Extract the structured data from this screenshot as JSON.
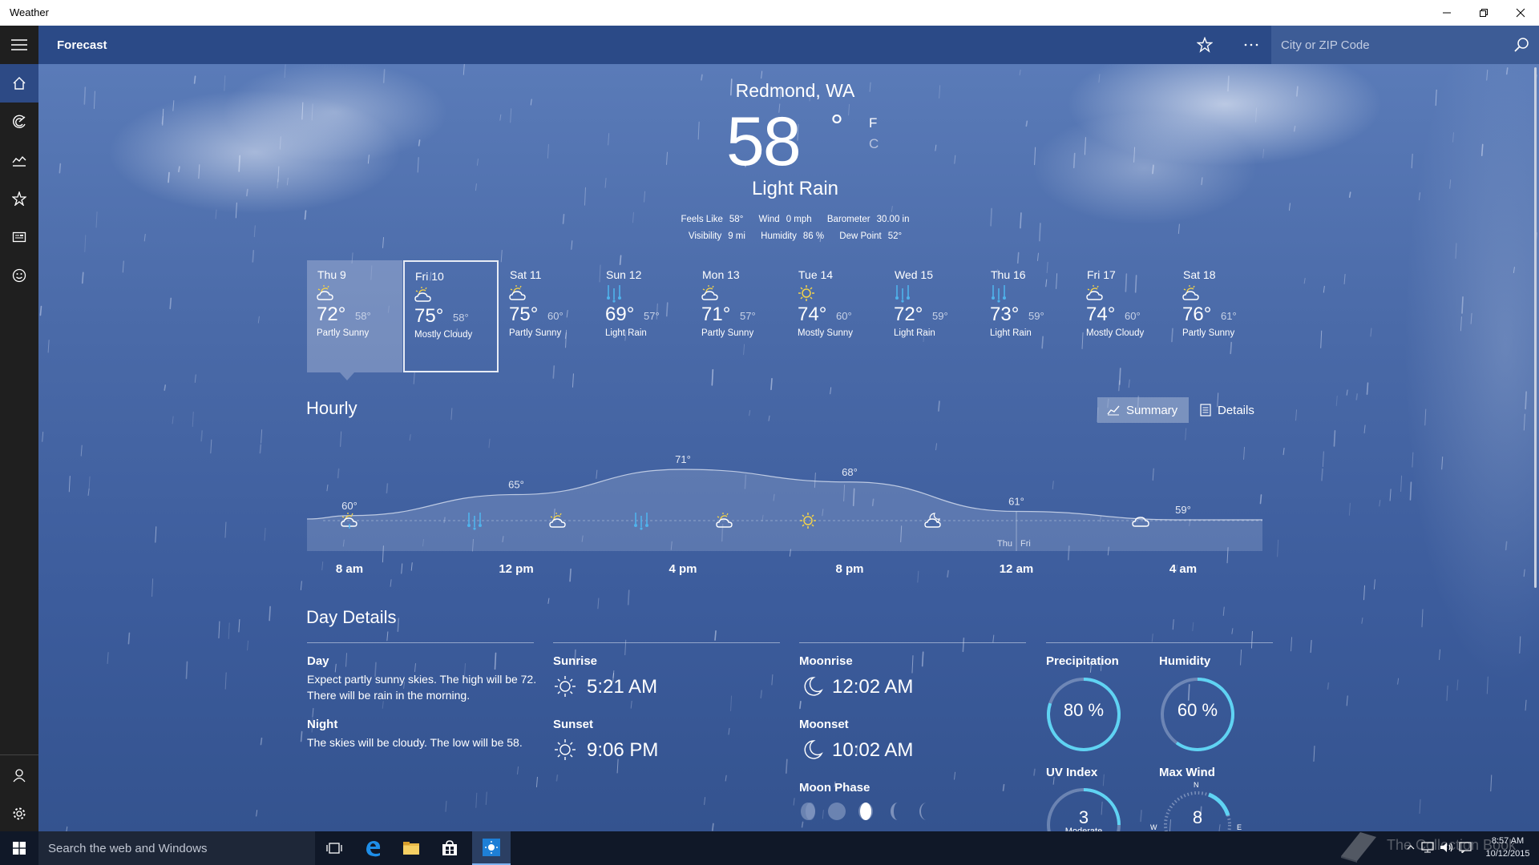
{
  "window": {
    "title": "Weather"
  },
  "header": {
    "title": "Forecast",
    "search_placeholder": "City or ZIP Code"
  },
  "nav": {
    "items": [
      "home-icon",
      "radar-icon",
      "chart-icon",
      "favorites-icon",
      "news-icon",
      "smiley-icon"
    ],
    "bottom": [
      "account-icon",
      "settings-icon"
    ]
  },
  "current": {
    "location": "Redmond, WA",
    "temp": "58",
    "degree": "°",
    "unit_f": "F",
    "unit_c": "C",
    "condition": "Light Rain",
    "feels_like_label": "Feels Like",
    "feels_like": "58°",
    "wind_label": "Wind",
    "wind": "0 mph",
    "barometer_label": "Barometer",
    "barometer": "30.00 in",
    "visibility_label": "Visibility",
    "visibility": "9 mi",
    "humidity_label": "Humidity",
    "humidity": "86 %",
    "dewpoint_label": "Dew Point",
    "dewpoint": "52°"
  },
  "daily": [
    {
      "day": "Thu 9",
      "hi": "72°",
      "lo": "58°",
      "cond": "Partly Sunny",
      "icon": "partly-sunny"
    },
    {
      "day": "Fri 10",
      "hi": "75°",
      "lo": "58°",
      "cond": "Mostly Cloudy",
      "icon": "partly-sunny"
    },
    {
      "day": "Sat 11",
      "hi": "75°",
      "lo": "60°",
      "cond": "Partly Sunny",
      "icon": "partly-sunny"
    },
    {
      "day": "Sun 12",
      "hi": "69°",
      "lo": "57°",
      "cond": "Light Rain",
      "icon": "rain"
    },
    {
      "day": "Mon 13",
      "hi": "71°",
      "lo": "57°",
      "cond": "Partly Sunny",
      "icon": "partly-sunny"
    },
    {
      "day": "Tue 14",
      "hi": "74°",
      "lo": "60°",
      "cond": "Mostly Sunny",
      "icon": "sunny"
    },
    {
      "day": "Wed 15",
      "hi": "72°",
      "lo": "59°",
      "cond": "Light Rain",
      "icon": "rain"
    },
    {
      "day": "Thu 16",
      "hi": "73°",
      "lo": "59°",
      "cond": "Light Rain",
      "icon": "rain"
    },
    {
      "day": "Fri 17",
      "hi": "74°",
      "lo": "60°",
      "cond": "Mostly Cloudy",
      "icon": "partly-sunny"
    },
    {
      "day": "Sat 18",
      "hi": "76°",
      "lo": "61°",
      "cond": "Partly Sunny",
      "icon": "partly-sunny"
    }
  ],
  "hourly": {
    "title": "Hourly",
    "summary_label": "Summary",
    "details_label": "Details",
    "times": [
      "8 am",
      "12 pm",
      "4 pm",
      "8 pm",
      "12 am",
      "4 am"
    ],
    "temps": [
      {
        "label": "60°",
        "value": 60
      },
      {
        "label": "65°",
        "value": 65
      },
      {
        "label": "71°",
        "value": 71
      },
      {
        "label": "68°",
        "value": 68
      },
      {
        "label": "61°",
        "value": 61
      },
      {
        "label": "59°",
        "value": 59
      }
    ],
    "icons": [
      "sun-rain",
      "rain",
      "partly-sunny",
      "rain",
      "partly-sunny",
      "sunny",
      "cloudy-night",
      "cloudy"
    ],
    "day_divider": [
      "Thu",
      "Fri"
    ]
  },
  "details": {
    "title": "Day Details",
    "day_label": "Day",
    "day_text": "Expect partly sunny skies. The high will be 72. There will be rain in the morning.",
    "night_label": "Night",
    "night_text": "The skies will be cloudy. The low will be 58.",
    "sunrise_label": "Sunrise",
    "sunrise": "5:21 AM",
    "sunset_label": "Sunset",
    "sunset": "9:06 PM",
    "moonrise_label": "Moonrise",
    "moonrise": "12:02 AM",
    "moonset_label": "Moonset",
    "moonset": "10:02 AM",
    "moonphase_label": "Moon Phase",
    "precip_label": "Precipitation",
    "precip": "80 %",
    "precip_frac": 0.8,
    "humidity_label": "Humidity",
    "humidity": "60 %",
    "humidity_frac": 0.6,
    "uv_label": "UV Index",
    "uv": "3",
    "uv_sub": "Moderate",
    "wind_label": "Max Wind",
    "wind": "8",
    "compass": [
      "N",
      "W",
      "E"
    ]
  },
  "colors": {
    "accent": "#5fd3f3",
    "header": "#2b4a87",
    "nav": "#1f1f1f",
    "rain_icon": "#4fb3ec",
    "sun_icon": "#f3d24a"
  }
}
